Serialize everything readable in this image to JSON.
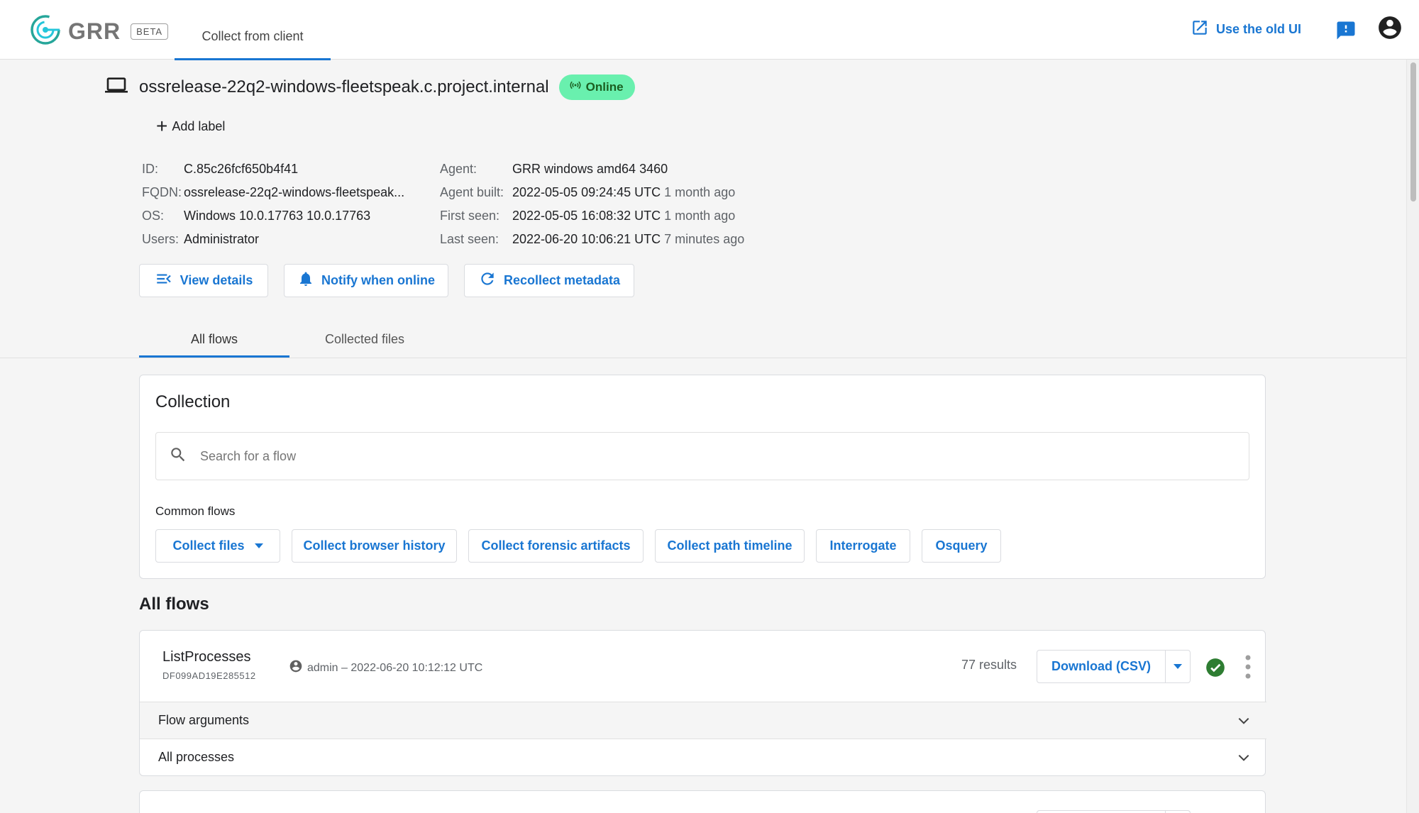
{
  "app": {
    "name": "GRR",
    "beta_badge": "BETA",
    "nav_tab": "Collect from client",
    "old_ui_link": "Use the old UI"
  },
  "client": {
    "hostname": "ossrelease-22q2-windows-fleetspeak.c.project.internal",
    "status": "Online",
    "add_label": "Add label",
    "info_left": [
      {
        "key": "ID:",
        "value": "C.85c26fcf650b4f41"
      },
      {
        "key": "FQDN:",
        "value": "ossrelease-22q2-windows-fleetspeak..."
      },
      {
        "key": "OS:",
        "value": "Windows 10.0.17763 10.0.17763"
      },
      {
        "key": "Users:",
        "value": "Administrator"
      }
    ],
    "info_right": [
      {
        "key": "Agent:",
        "value": "GRR windows amd64 3460",
        "relative": ""
      },
      {
        "key": "Agent built:",
        "value": "2022-05-05 09:24:45 UTC",
        "relative": "1 month ago"
      },
      {
        "key": "First seen:",
        "value": "2022-05-05 16:08:32 UTC",
        "relative": "1 month ago"
      },
      {
        "key": "Last seen:",
        "value": "2022-06-20 10:06:21 UTC",
        "relative": "7 minutes ago"
      }
    ],
    "actions": {
      "view_details": "View details",
      "notify": "Notify when online",
      "recollect": "Recollect metadata"
    }
  },
  "tabs": {
    "all_flows": "All flows",
    "collected_files": "Collected files"
  },
  "collection": {
    "title": "Collection",
    "search_placeholder": "Search for a flow",
    "common_flows_label": "Common flows",
    "common_flows": {
      "collect_files": "Collect files",
      "browser_history": "Collect browser history",
      "forensic_artifacts": "Collect forensic artifacts",
      "path_timeline": "Collect path timeline",
      "interrogate": "Interrogate",
      "osquery": "Osquery"
    }
  },
  "all_flows": {
    "title": "All flows",
    "flows": [
      {
        "name": "ListProcesses",
        "id": "DF099AD19E285512",
        "meta": "admin – 2022-06-20 10:12:12 UTC",
        "results": "77 results",
        "download_label": "Download (CSV)",
        "sections": [
          "Flow arguments",
          "All processes"
        ]
      }
    ]
  },
  "colors": {
    "accent": "#1976d2",
    "online_bg": "#69f0ae",
    "success": "#2e7d32"
  },
  "icons": [
    "grr-logo-icon",
    "open-in-new-icon",
    "feedback-icon",
    "account-icon",
    "laptop-icon",
    "signal-icon",
    "add-icon",
    "view-details-icon",
    "bell-icon",
    "refresh-icon",
    "search-icon",
    "caret-down-icon",
    "person-icon",
    "check-circle-icon",
    "more-vert-icon",
    "chevron-down-icon"
  ]
}
